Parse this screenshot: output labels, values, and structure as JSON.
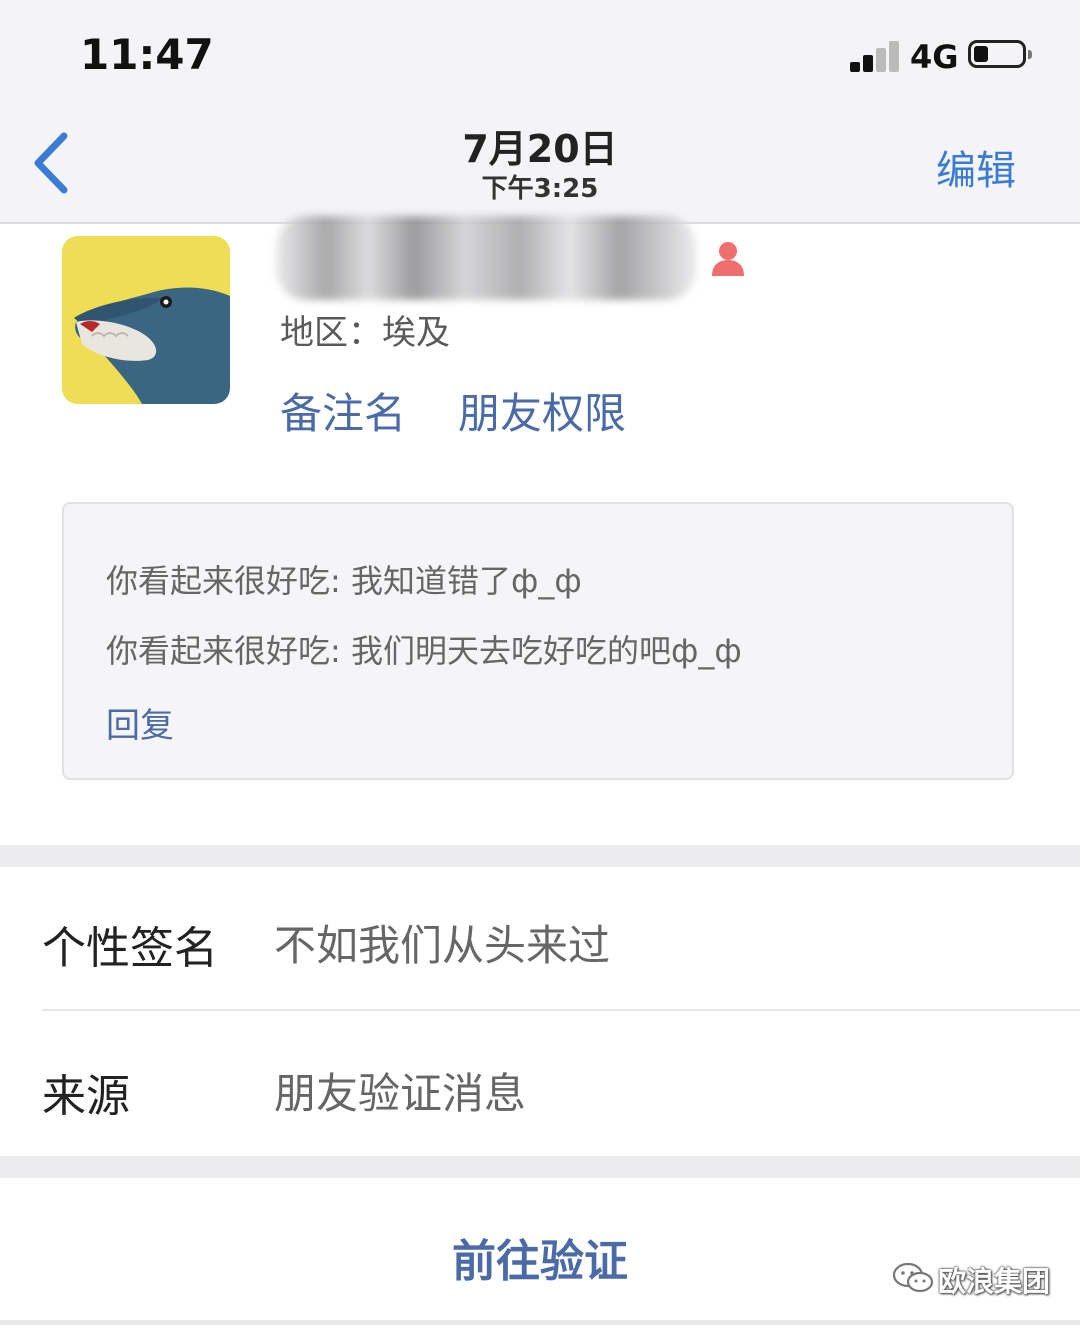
{
  "status_bar": {
    "time": "11:47",
    "network": "4G"
  },
  "nav": {
    "date": "7月20日",
    "time": "下午3:25",
    "edit_label": "编辑"
  },
  "profile": {
    "region": "地区：埃及",
    "remark_label": "备注名",
    "permission_label": "朋友权限"
  },
  "messages": {
    "items": [
      "你看起来很好吃: 我知道错了ф_ф",
      "你看起来很好吃: 我们明天去吃好吃的吧ф_ф"
    ],
    "reply_label": "回复"
  },
  "info": {
    "signature_label": "个性签名",
    "signature_value": "不如我们从头来过",
    "source_label": "来源",
    "source_value": "朋友验证消息"
  },
  "action": {
    "verify_label": "前往验证"
  },
  "watermark": "欧浪集团",
  "colors": {
    "link": "#4a6aa8",
    "nav_accent": "#3a7cd5",
    "gender_female": "#ef6f6f"
  }
}
